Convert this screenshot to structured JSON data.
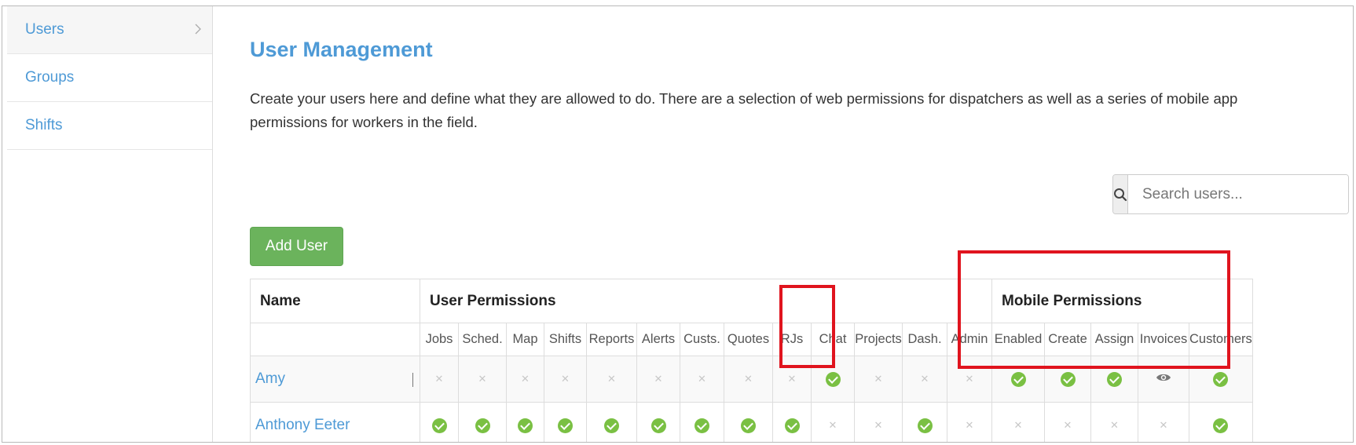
{
  "sidebar": {
    "items": [
      {
        "label": "Users",
        "active": true
      },
      {
        "label": "Groups",
        "active": false
      },
      {
        "label": "Shifts",
        "active": false
      }
    ]
  },
  "page": {
    "title": "User Management",
    "description": "Create your users here and define what they are allowed to do. There are a selection of web permissions for dispatchers as well as a series of mobile app permissions for workers in the field."
  },
  "search": {
    "placeholder": "Search users...",
    "value": ""
  },
  "toolbar": {
    "add_user_label": "Add User"
  },
  "table": {
    "name_header": "Name",
    "user_permissions_header": "User Permissions",
    "mobile_permissions_header": "Mobile Permissions",
    "user_permission_columns": [
      "Jobs",
      "Sched.",
      "Map",
      "Shifts",
      "Reports",
      "Alerts",
      "Custs.",
      "Quotes",
      "RJs",
      "Chat",
      "Projects",
      "Dash.",
      "Admin"
    ],
    "mobile_permission_columns": [
      "Enabled",
      "Create",
      "Assign",
      "Invoices",
      "Customers"
    ],
    "rows": [
      {
        "name": "Amy",
        "user": [
          "no",
          "no",
          "no",
          "no",
          "no",
          "no",
          "no",
          "no",
          "no",
          "yes",
          "no",
          "no",
          "no"
        ],
        "mobile": [
          "yes",
          "yes",
          "yes",
          "view",
          "yes"
        ]
      },
      {
        "name": "Anthony Eeter",
        "user": [
          "yes",
          "yes",
          "yes",
          "yes",
          "yes",
          "yes",
          "yes",
          "yes",
          "yes",
          "no",
          "no",
          "yes",
          "no"
        ],
        "mobile": [
          "no",
          "no",
          "no",
          "no",
          "yes"
        ]
      }
    ]
  },
  "colors": {
    "accent": "#4e9ad6",
    "success": "#7ac043",
    "button": "#6bb35c",
    "highlight": "#e0141e"
  },
  "icons": {
    "yes": "check-circle-icon",
    "no": "x-mark-icon",
    "view": "eye-icon",
    "search": "search-icon"
  }
}
